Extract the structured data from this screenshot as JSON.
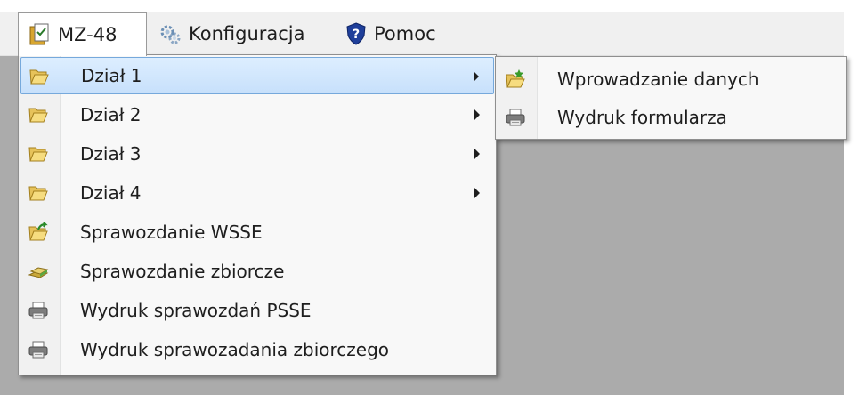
{
  "menubar": {
    "items": [
      {
        "label": "MZ-48",
        "icon": "document-check-icon"
      },
      {
        "label": "Konfiguracja",
        "icon": "gears-icon"
      },
      {
        "label": "Pomoc",
        "icon": "help-shield-icon"
      }
    ]
  },
  "main_menu": {
    "items": [
      {
        "label": "Dział 1",
        "icon": "folder-open-icon",
        "submenu": true,
        "highlighted": true
      },
      {
        "label": "Dział 2",
        "icon": "folder-open-icon",
        "submenu": true
      },
      {
        "label": "Dział 3",
        "icon": "folder-open-icon",
        "submenu": true
      },
      {
        "label": "Dział 4",
        "icon": "folder-open-icon",
        "submenu": true
      },
      {
        "label": "Sprawozdanie WSSE",
        "icon": "folder-export-icon"
      },
      {
        "label": "Sprawozdanie zbiorcze",
        "icon": "stack-icon"
      },
      {
        "label": "Wydruk sprawozdań PSSE",
        "icon": "printer-icon"
      },
      {
        "label": "Wydruk sprawozadania zbiorczego",
        "icon": "printer-icon"
      }
    ]
  },
  "sub_menu": {
    "items": [
      {
        "label": "Wprowadzanie danych",
        "icon": "folder-star-icon"
      },
      {
        "label": "Wydruk formularza",
        "icon": "printer-icon"
      }
    ]
  },
  "colors": {
    "highlight": "#c7e0fb",
    "highlight_border": "#76a9dc",
    "workspace": "#ababab",
    "menubar": "#f0f0f0"
  }
}
